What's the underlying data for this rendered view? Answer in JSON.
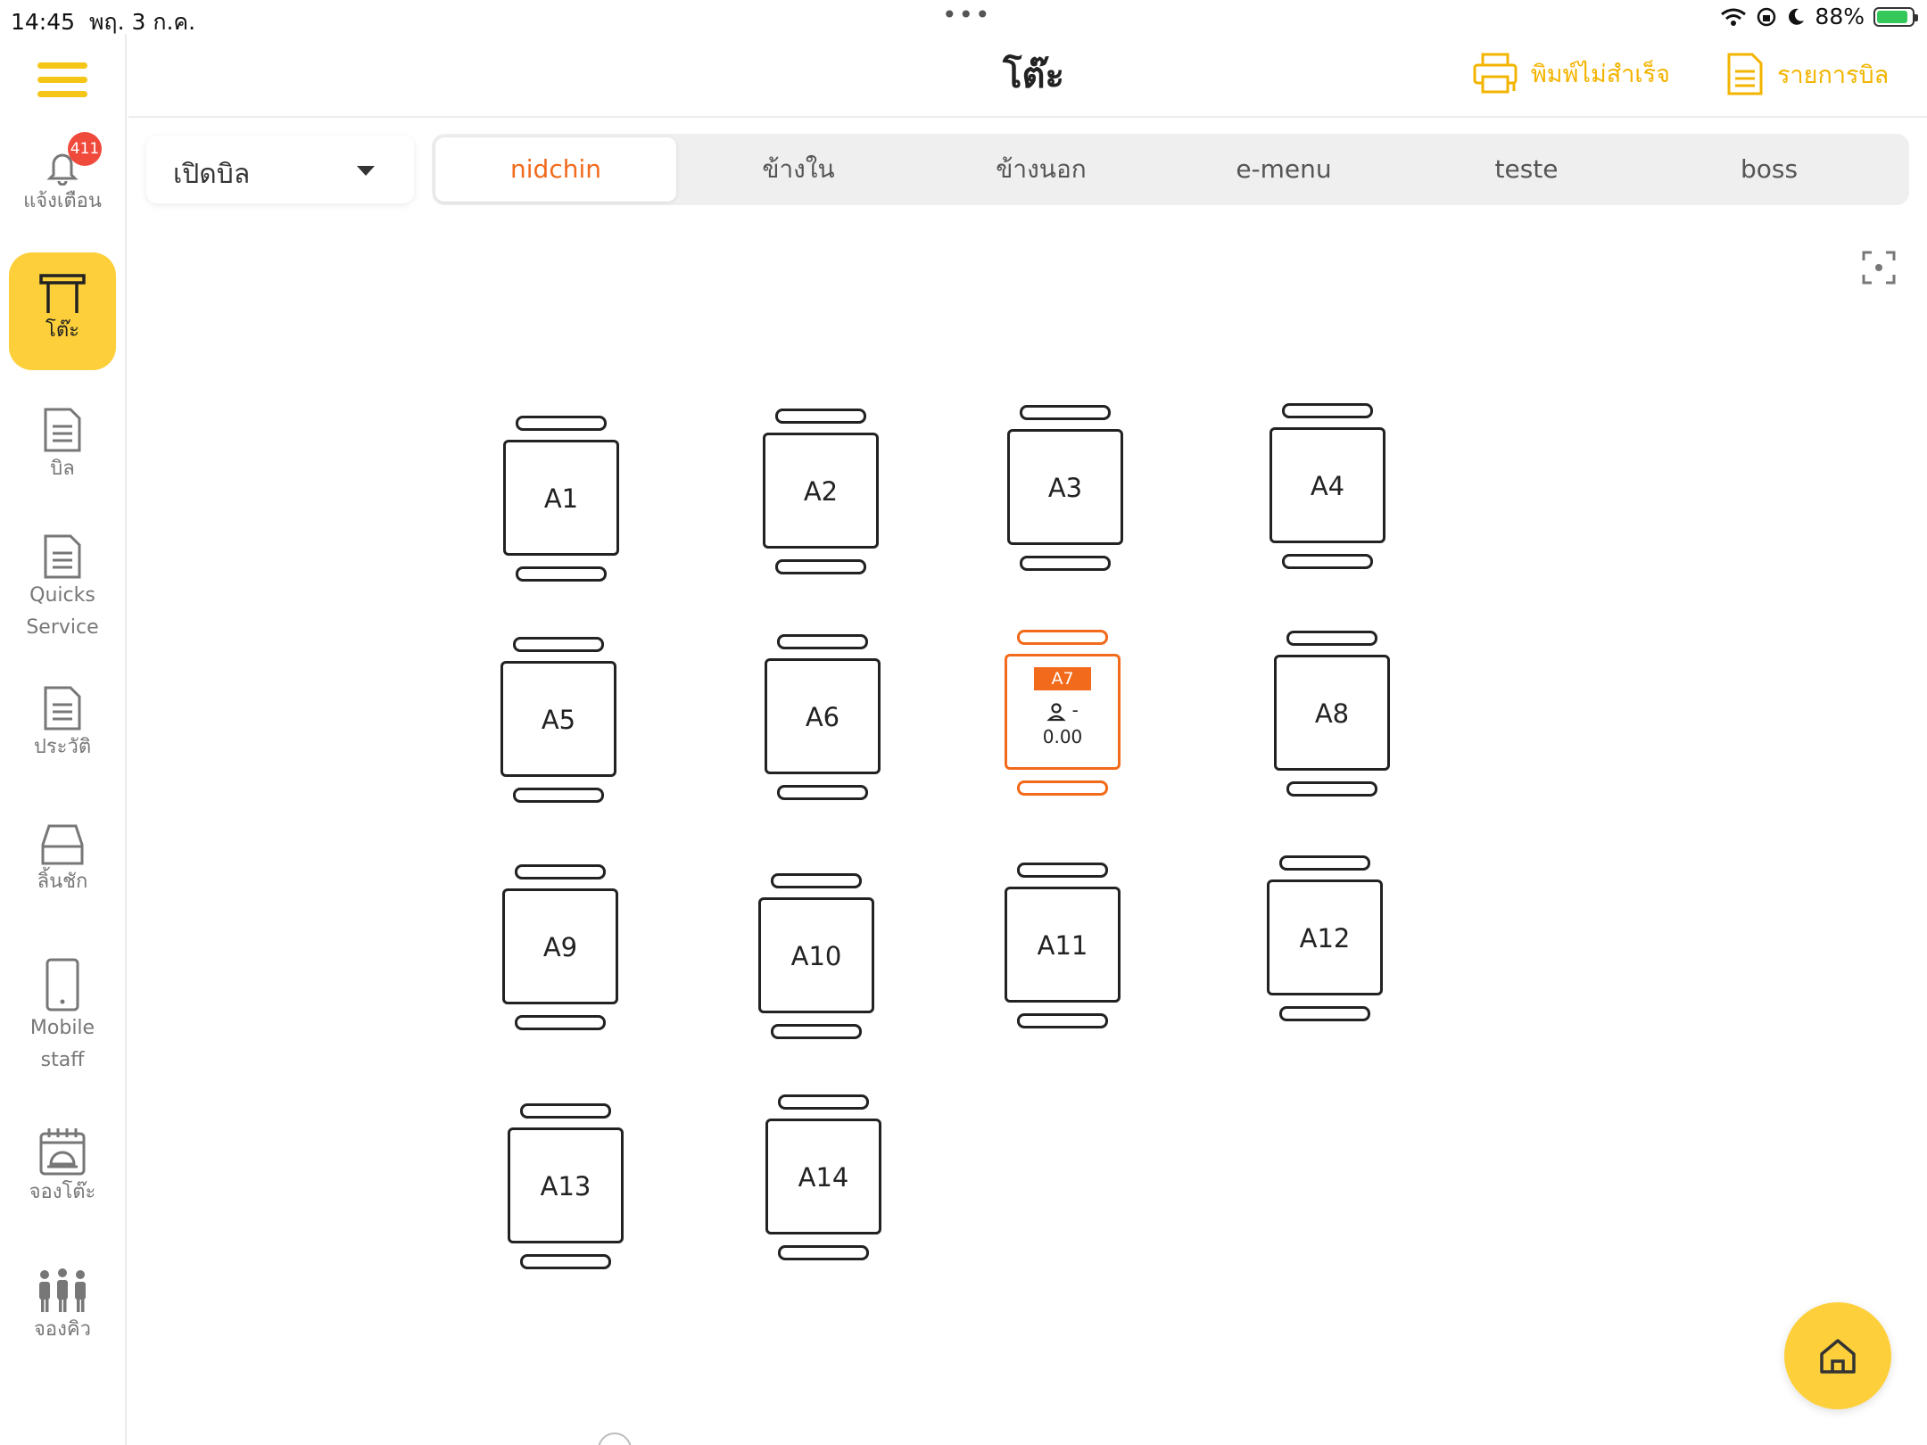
{
  "status_bar": {
    "time": "14:45",
    "date": "พฤ. 3 ก.ค.",
    "dots": "•••",
    "battery": "88%"
  },
  "sidebar": {
    "badge_count": "411",
    "items": [
      {
        "label": "แจ้งเตือน",
        "icon": "bell-icon"
      },
      {
        "label": "โต๊ะ",
        "icon": "table-icon"
      },
      {
        "label": "บิล",
        "icon": "document-icon"
      },
      {
        "label": "Quicks",
        "label2": "Service",
        "icon": "document-icon"
      },
      {
        "label": "ประวัติ",
        "icon": "document-icon"
      },
      {
        "label": "ลิ้นชัก",
        "icon": "drawer-icon"
      },
      {
        "label": "Mobile",
        "label2": "staff",
        "icon": "mobile-icon"
      },
      {
        "label": "จองโต๊ะ",
        "icon": "calendar-icon"
      },
      {
        "label": "จองคิว",
        "icon": "people-icon"
      }
    ]
  },
  "header": {
    "title": "โต๊ะ",
    "print_failed_label": "พิมพ์ไม่สำเร็จ",
    "bill_list_label": "รายการบิล"
  },
  "filter": {
    "selected": "เปิดบิล"
  },
  "tabs": [
    "nidchin",
    "ข้างใน",
    "ข้างนอก",
    "e-menu",
    "teste",
    "boss"
  ],
  "active_tab": 0,
  "tables": {
    "A1": "A1",
    "A2": "A2",
    "A3": "A3",
    "A4": "A4",
    "A5": "A5",
    "A6": "A6",
    "A7": "A7",
    "A8": "A8",
    "A9": "A9",
    "A10": "A10",
    "A11": "A11",
    "A12": "A12",
    "A13": "A13",
    "A14": "A14"
  },
  "occupied": {
    "table": "A7",
    "guests": "-",
    "amount": "0.00"
  },
  "colors": {
    "accent": "#fdd03b",
    "active_tab": "#f26a1b",
    "badge": "#f04a3d",
    "battery": "#34c759"
  }
}
